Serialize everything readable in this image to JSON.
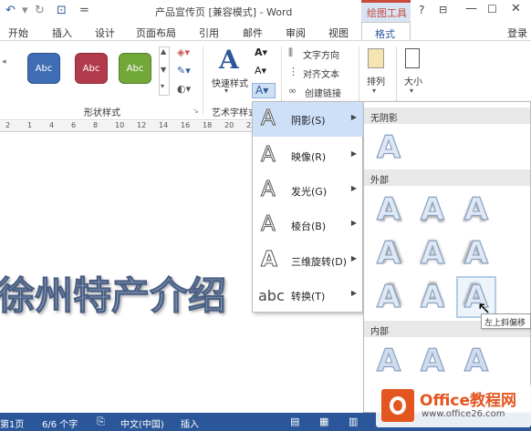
{
  "window": {
    "title": "产品宣传页 [兼容模式] - Word",
    "context_tab": "绘图工具",
    "help": "?"
  },
  "quick_access": {
    "undo": "↶",
    "redo": "↻",
    "preview": "⊡",
    "customize": "="
  },
  "tabs": [
    "开始",
    "插入",
    "设计",
    "页面布局",
    "引用",
    "邮件",
    "审阅",
    "视图",
    "格式"
  ],
  "signin": "登录",
  "ribbon": {
    "shape_styles": {
      "presets": [
        {
          "label": "Abc",
          "color": "#3e6db5"
        },
        {
          "label": "Abc",
          "color": "#b23b4b"
        },
        {
          "label": "Abc",
          "color": "#72a83a"
        }
      ],
      "group_label": "形状样式"
    },
    "quick_styles": {
      "label": "快速样式"
    },
    "wordart_group_label": "艺术字样式",
    "text": {
      "direction": "文字方向",
      "align": "对齐文本",
      "link": "创建链接"
    },
    "arrange": {
      "label": "排列"
    },
    "size": {
      "label": "大小"
    }
  },
  "ruler": {
    "marks": [
      "2",
      "1",
      "4",
      "6",
      "8",
      "10",
      "12",
      "14",
      "16",
      "18",
      "20",
      "22"
    ]
  },
  "doc": {
    "heading_visible": "徐州特产介绍"
  },
  "effects_menu": {
    "items": [
      {
        "glyph": "A",
        "label": "阴影(S)",
        "active": true
      },
      {
        "glyph": "A",
        "label": "映像(R)"
      },
      {
        "glyph": "A",
        "label": "发光(G)"
      },
      {
        "glyph": "A",
        "label": "棱台(B)"
      },
      {
        "glyph": "A",
        "label": "三维旋转(D)"
      },
      {
        "glyph": "abc",
        "label": "转换(T)"
      }
    ]
  },
  "shadow_gallery": {
    "sections": [
      {
        "title": "无阴影"
      },
      {
        "title": "外部"
      },
      {
        "title": "内部"
      }
    ],
    "tooltip": "左上斜偏移",
    "glyph": "A"
  },
  "statusbar": {
    "page": "第1页",
    "words": "6/6 个字",
    "language": "中文(中国)",
    "mode": "插入"
  },
  "watermark": {
    "brand": "Office教程网",
    "url": "www.office26.com"
  }
}
